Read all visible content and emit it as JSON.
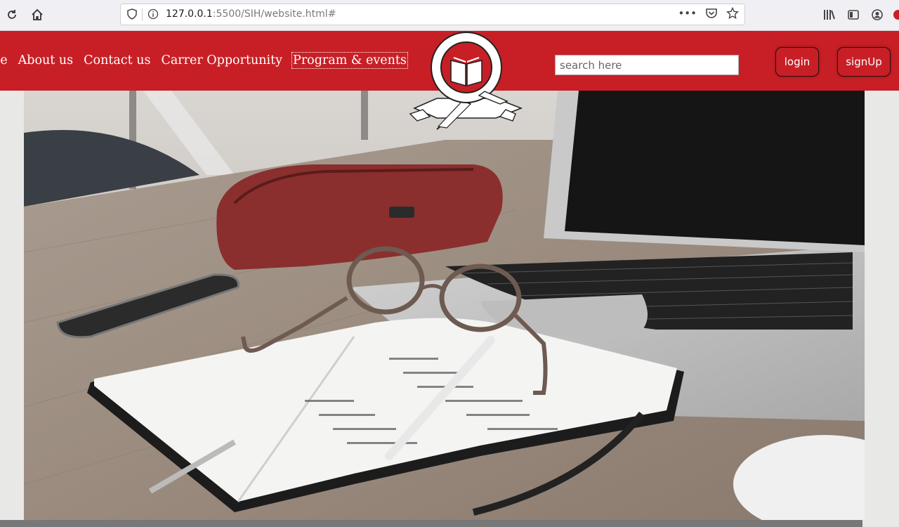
{
  "browser": {
    "url_host": "127.0.0.1",
    "url_rest": ":5500/SIH/website.html#",
    "icons": [
      "reload-icon",
      "home-icon",
      "shield-icon",
      "info-icon",
      "more-icon",
      "pocket-icon",
      "star-icon",
      "library-icon",
      "sidebar-icon",
      "account-icon"
    ]
  },
  "nav": {
    "links": [
      "ne",
      "About us",
      "Contact us",
      "Carrer Opportunity",
      "Program & events"
    ],
    "active_index": 4
  },
  "search": {
    "placeholder": "search here"
  },
  "auth": {
    "login_label": "login",
    "signup_label": "signUp"
  },
  "colors": {
    "brand_red": "#c81f26",
    "text_white": "#ffffff"
  }
}
